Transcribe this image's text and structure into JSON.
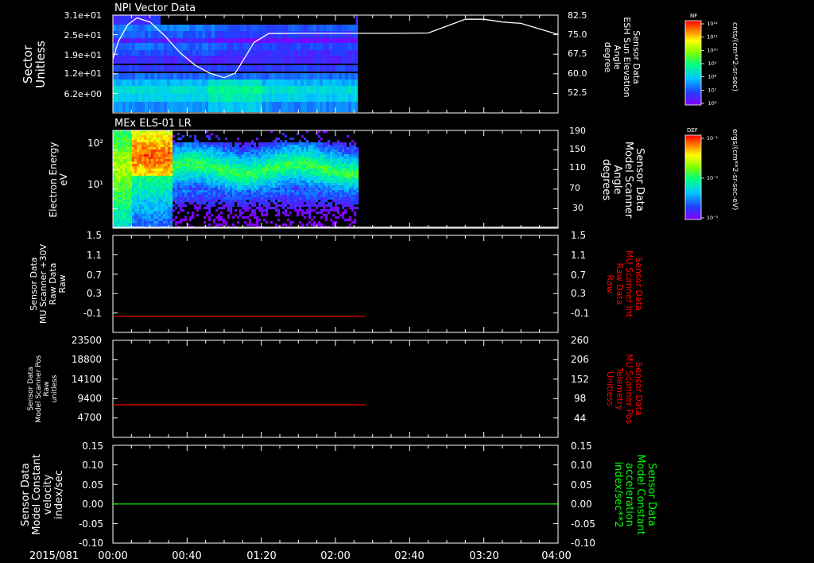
{
  "date_label": "2015/081",
  "x_ticks": [
    "00:00",
    "00:40",
    "01:20",
    "02:00",
    "02:40",
    "03:20",
    "04:00"
  ],
  "panels": [
    {
      "title": "NPI Vector Data",
      "left_label": [
        "Sector",
        "Unitless"
      ],
      "left_ticks": [
        "3.1e+01",
        "2.5e+01",
        "1.9e+01",
        "1.2e+01",
        "6.2e+00"
      ],
      "right_label": [
        "Sensor Data",
        "ESH Sun Elevation",
        "Angle",
        "degree"
      ],
      "right_ticks": [
        "82.5",
        "75.0",
        "67.5",
        "60.0",
        "52.5"
      ],
      "right_label_color": "#ffffff",
      "colorbar": {
        "tag": "NF",
        "unit": "cnts/(cm**2-sr-sec)",
        "ticks": [
          "10¹²",
          "10¹¹",
          "10¹⁰",
          "10⁹",
          "10⁸",
          "10⁷",
          "10⁶"
        ]
      }
    },
    {
      "title": "MEx ELS-01 LR",
      "left_label": [
        "Electron Energy",
        "eV"
      ],
      "left_ticks": [
        "10²",
        "10¹"
      ],
      "right_label": [
        "Sensor Data",
        "Model Scanner",
        "Angle",
        "degrees"
      ],
      "right_ticks": [
        "190",
        "150",
        "110",
        "70",
        "30"
      ],
      "right_label_color": "#ffffff",
      "colorbar": {
        "tag": "DEF",
        "unit": "ergs/(cm**2-sr-sec-eV)",
        "ticks": [
          "10⁻¹",
          "10⁻²",
          "10⁻³"
        ]
      }
    },
    {
      "title": "",
      "left_label": [
        "Sensor Data",
        "MU Scanner +30V",
        "Raw Data",
        "Raw"
      ],
      "left_ticks": [
        "1.5",
        "1.1",
        "0.7",
        "0.3",
        "-0.1"
      ],
      "right_label": [
        "Sensor Data",
        "MU Scanner Int",
        "Raw Data",
        "Raw"
      ],
      "right_ticks": [
        "1.5",
        "1.1",
        "0.7",
        "0.3",
        "-0.1"
      ],
      "right_label_color": "#ff0000"
    },
    {
      "title": "",
      "left_label": [
        "Sensor Data",
        "Model Scanner Pos",
        "Raw",
        "unitless"
      ],
      "left_ticks": [
        "23500",
        "18800",
        "14100",
        "9400",
        "4700"
      ],
      "right_label": [
        "Sensor Data",
        "MU Scanner Pos",
        "Telemetry",
        "Unitless"
      ],
      "right_ticks": [
        "260",
        "206",
        "152",
        "98",
        "44"
      ],
      "right_label_color": "#ff0000"
    },
    {
      "title": "",
      "left_label": [
        "Sensor Data",
        "Model Constant",
        "velocity",
        "index/sec"
      ],
      "left_ticks": [
        "0.15",
        "0.10",
        "0.05",
        "0.00",
        "-0.05",
        "-0.10"
      ],
      "right_label": [
        "Sensor Data",
        "Model Constant",
        "acceleration",
        "index/sec**2"
      ],
      "right_ticks": [
        "0.15",
        "0.10",
        "0.05",
        "0.00",
        "-0.05",
        "-0.10"
      ],
      "right_label_color": "#00ff00"
    }
  ],
  "chart_data": [
    {
      "type": "heatmap",
      "title": "NPI Vector Data",
      "x_range": [
        "00:00",
        "04:00"
      ],
      "data_end": "02:11",
      "ylabel": "Sector Unitless",
      "y_ticks": [
        31,
        25,
        19,
        12,
        6.2
      ],
      "overlay_series": {
        "ylabel": "Sensor Data ESH Sun Elevation Angle degree",
        "ylim": [
          47,
          82.5
        ],
        "color": "#ffffff",
        "x_minutes": [
          0,
          3,
          8,
          13,
          20,
          28,
          36,
          44,
          52,
          60,
          66,
          72,
          76,
          84,
          100,
          120,
          150,
          170,
          180,
          190,
          200,
          210,
          220,
          240
        ],
        "values": [
          66.5,
          73,
          79,
          81.5,
          80,
          75,
          69,
          64.5,
          61.5,
          59.8,
          61.5,
          68,
          72.5,
          75.8,
          75.9,
          75.9,
          75.9,
          76,
          78.5,
          81,
          81,
          80,
          79.5,
          75.5
        ]
      }
    },
    {
      "type": "heatmap",
      "title": "MEx ELS-01 LR",
      "x_range": [
        "00:00",
        "04:00"
      ],
      "data_end": "02:12",
      "ylabel": "Electron Energy eV",
      "y_scale": "log",
      "y_ticks": [
        100,
        10
      ],
      "overlay_series": {
        "ylabel": "Sensor Data Model Scanner Angle degrees",
        "ylim": [
          10,
          190
        ],
        "color": "#ffffff",
        "x_minutes": [
          0,
          240
        ],
        "values": [
          12,
          12
        ]
      }
    },
    {
      "type": "line",
      "ylabel": "Sensor Data MU Scanner +30V Raw Data Raw",
      "ylim": [
        -0.3,
        1.5
      ],
      "right_ylabel": "Sensor Data MU Scanner Int Raw Data Raw",
      "series": [
        {
          "color": "#ff0000",
          "x_minutes": [
            0,
            136
          ],
          "values": [
            0,
            0
          ]
        }
      ]
    },
    {
      "type": "line",
      "ylabel": "Sensor Data Model Scanner Pos Raw unitless",
      "ylim": [
        0,
        23500
      ],
      "right_ylabel": "Sensor Data MU Scanner Pos Telemetry Unitless",
      "right_ylim": [
        0,
        260
      ],
      "series": [
        {
          "color": "#ff0000",
          "x_minutes": [
            0,
            136
          ],
          "values": [
            7900,
            7900
          ]
        }
      ]
    },
    {
      "type": "line",
      "ylabel": "Sensor Data Model Constant velocity index/sec",
      "ylim": [
        -0.1,
        0.15
      ],
      "right_ylabel": "Sensor Data Model Constant acceleration index/sec**2",
      "series": [
        {
          "color": "#00ff00",
          "x_minutes": [
            0,
            240
          ],
          "values": [
            0,
            0
          ]
        }
      ]
    }
  ]
}
